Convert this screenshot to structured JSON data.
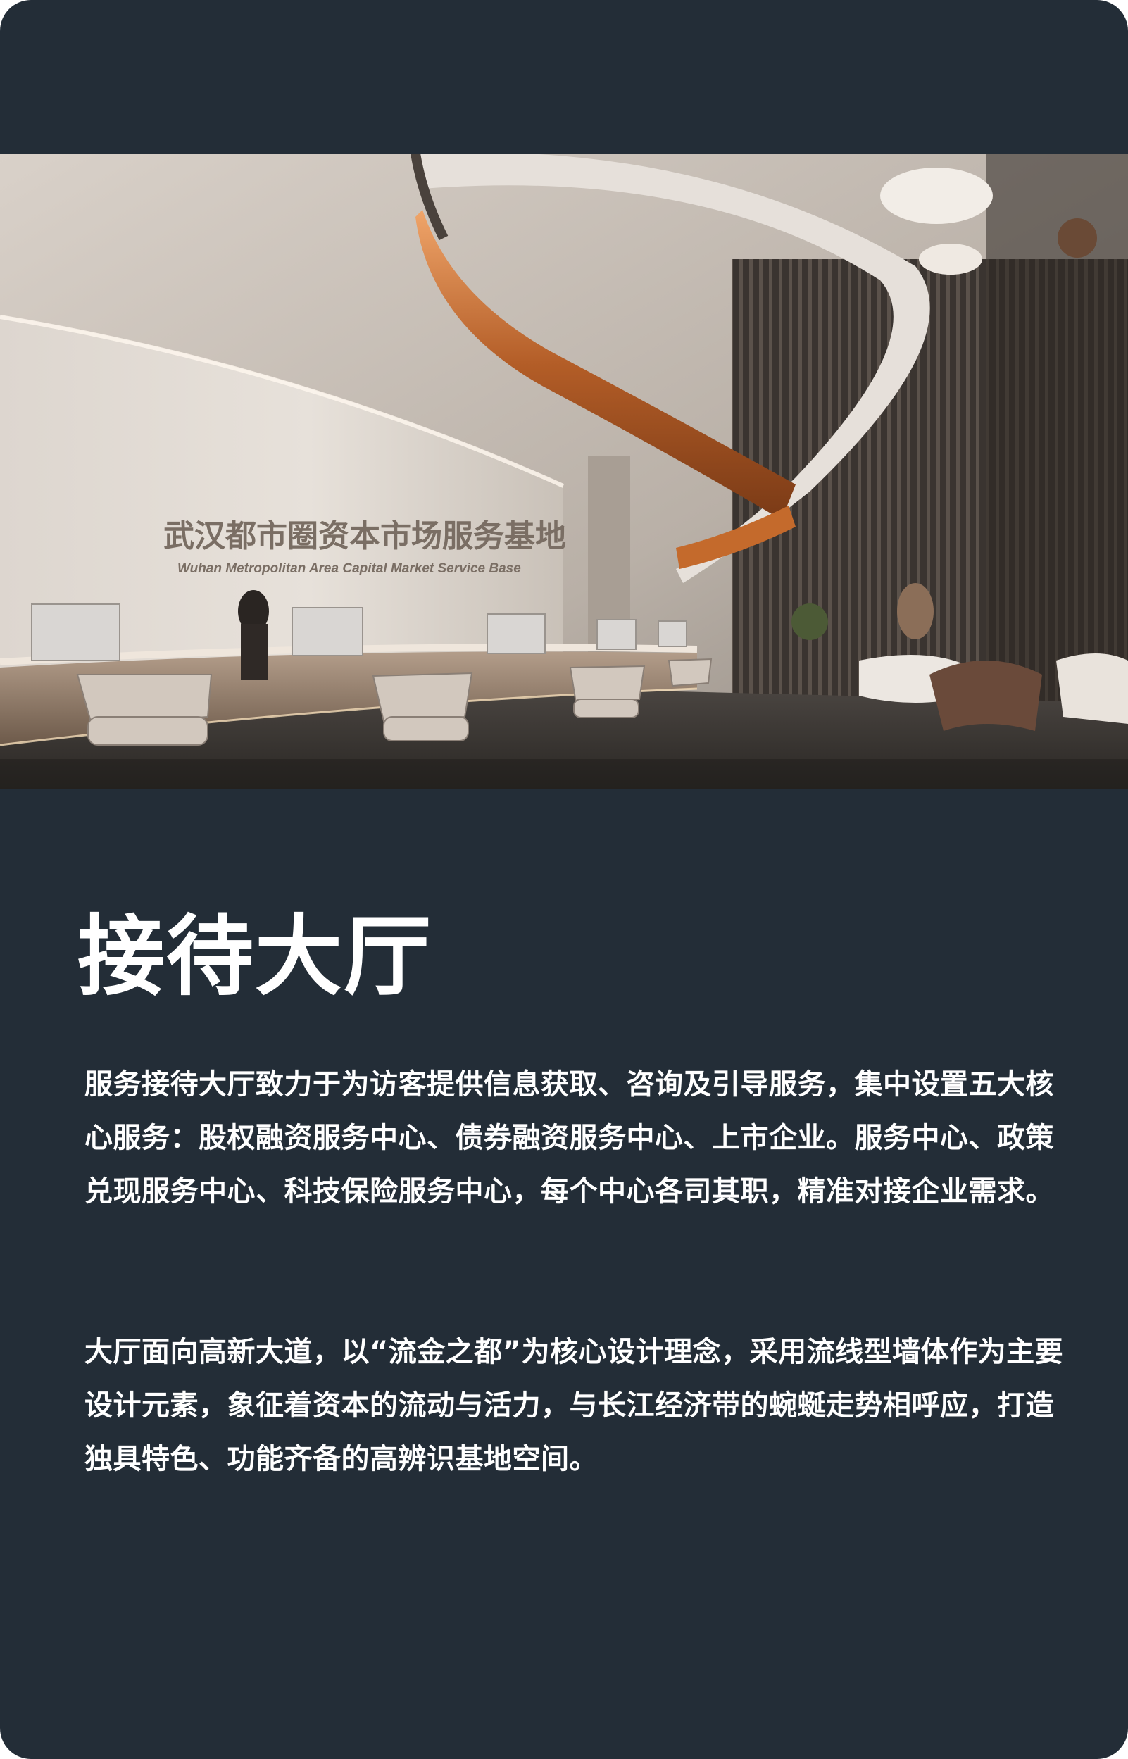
{
  "photo": {
    "sign_cn": "武汉都市圈资本市场服务基地",
    "sign_en": "Wuhan Metropolitan Area Capital Market Service Base"
  },
  "heading": "接待大厅",
  "paragraphs": [
    "服务接待大厅致力于为访客提供信息获取、咨询及引导服务，集中设置五大核心服务：股权融资服务中心、债券融资服务中心、上市企业。服务中心、政策兑现服务中心、科技保险服务中心，每个中心各司其职，精准对接企业需求。",
    "大厅面向高新大道，以“流金之都”为核心设计理念，采用流线型墙体作为主要设计元素，象征着资本的流动与活力，与长江经济带的蜿蜒走势相呼应，打造独具特色、功能齐备的高辨识基地空间。"
  ]
}
